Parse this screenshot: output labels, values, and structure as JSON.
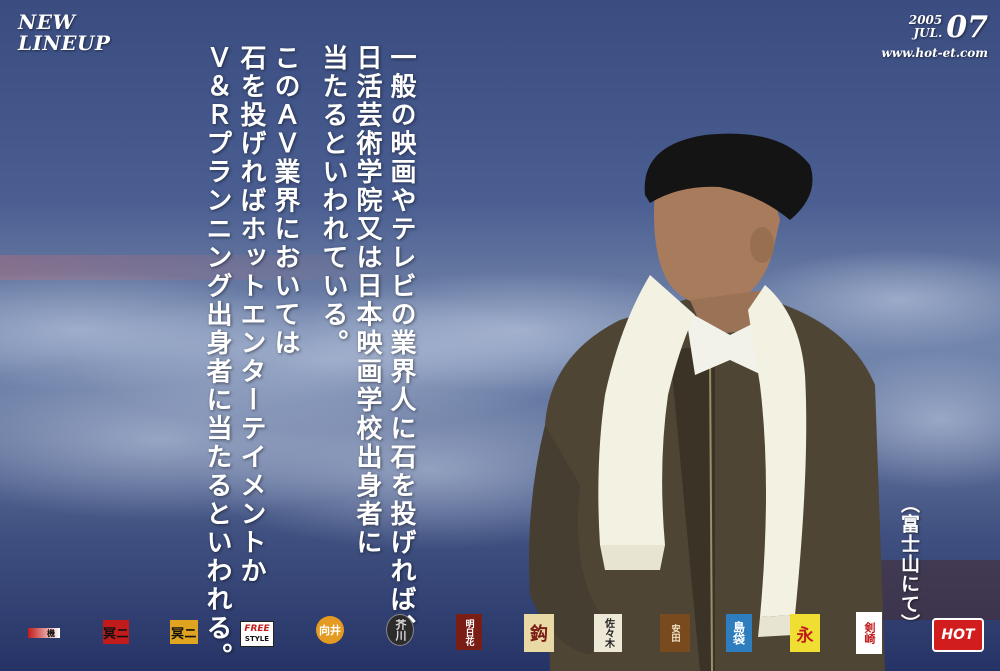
{
  "header": {
    "line1": "NEW",
    "line2": "LINEUP"
  },
  "issue": {
    "year": "2005",
    "month": "JUL.",
    "number": "07",
    "website": "www.hot-et.com"
  },
  "copy": {
    "paragraph1": [
      "一般の映画やテレビの業界人に石を投げれば、",
      "日活芸術学院又は日本映画学校出身者に",
      "当たるといわれている。"
    ],
    "paragraph2": [
      "このＡＶ業界においては",
      "石を投げればホットエンターテイメントか",
      "Ｖ＆Ｒプランニング出身者に当たるといわれる。"
    ]
  },
  "caption": "（富士山にて）",
  "logos": [
    {
      "icon": "logo-1-icon",
      "text": "",
      "bg": "#c21b1b",
      "fg": "#ffffff"
    },
    {
      "icon": "logo-2-icon",
      "text": "",
      "bg": "#c21b1b",
      "fg": "#111111"
    },
    {
      "icon": "logo-3-icon",
      "text": "",
      "bg": "#e0a520",
      "fg": "#111111"
    },
    {
      "icon": "logo-freestyle-icon",
      "text": "FREE STYLE",
      "bg": "#ffffff",
      "fg": "#c21b1b"
    },
    {
      "icon": "logo-mukai-icon",
      "text": "向井",
      "bg": "#e59b22",
      "fg": "#ffffff"
    },
    {
      "icon": "logo-akutagawa-icon",
      "text": "芥川",
      "bg": "#2c2c2c",
      "fg": "#dddddd"
    },
    {
      "icon": "logo-7-icon",
      "text": "",
      "bg": "#7a1d15",
      "fg": "#ffffff"
    },
    {
      "icon": "logo-8-icon",
      "text": "",
      "bg": "#e9d9a5",
      "fg": "#7a1d15"
    },
    {
      "icon": "logo-sasaki-icon",
      "text": "佐々木",
      "bg": "#eee8d6",
      "fg": "#222222"
    },
    {
      "icon": "logo-10-icon",
      "text": "",
      "bg": "#7a4a1f",
      "fg": "#f2e4c5"
    },
    {
      "icon": "logo-shimabukuro-icon",
      "text": "島袋",
      "bg": "#2d7dbf",
      "fg": "#ffffff"
    },
    {
      "icon": "logo-12-icon",
      "text": "",
      "bg": "#f0de33",
      "fg": "#c21b1b"
    },
    {
      "icon": "logo-13-icon",
      "text": "",
      "bg": "#ffffff",
      "fg": "#c21b1b"
    },
    {
      "icon": "logo-hot-icon",
      "text": "HOT",
      "bg": "#d11d1d",
      "fg": "#ffffff"
    }
  ]
}
